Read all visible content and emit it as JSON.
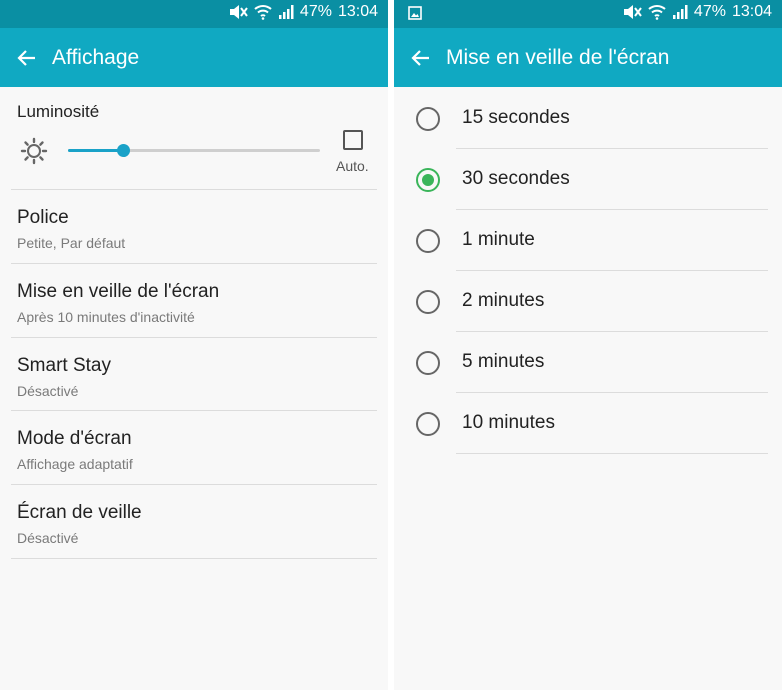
{
  "status_bar": {
    "battery": "47%",
    "time": "13:04",
    "icons": [
      "mute-icon",
      "wifi-icon",
      "signal-icon"
    ],
    "right_panel_notification_icon": "image-icon"
  },
  "colors": {
    "status_bar": "#0a8fa3",
    "app_bar": "#10a9c2",
    "slider_accent": "#1aa2c8",
    "radio_checked": "#3ab55a",
    "background": "#f8f8f8"
  },
  "display_screen": {
    "title": "Affichage",
    "brightness": {
      "label": "Luminosité",
      "level": 0.22,
      "auto_label": "Auto.",
      "auto_checked": false
    },
    "settings": [
      {
        "title": "Police",
        "subtitle": "Petite, Par défaut"
      },
      {
        "title": "Mise en veille de l'écran",
        "subtitle": "Après 10 minutes d'inactivité"
      },
      {
        "title": "Smart Stay",
        "subtitle": "Désactivé"
      },
      {
        "title": "Mode d'écran",
        "subtitle": "Affichage adaptatif"
      },
      {
        "title": "Écran de veille",
        "subtitle": "Désactivé"
      }
    ]
  },
  "timeout_screen": {
    "title": "Mise en veille de l'écran",
    "options": [
      {
        "label": "15 secondes",
        "selected": false
      },
      {
        "label": "30 secondes",
        "selected": true
      },
      {
        "label": "1 minute",
        "selected": false
      },
      {
        "label": "2 minutes",
        "selected": false
      },
      {
        "label": "5 minutes",
        "selected": false
      },
      {
        "label": "10 minutes",
        "selected": false
      }
    ]
  }
}
